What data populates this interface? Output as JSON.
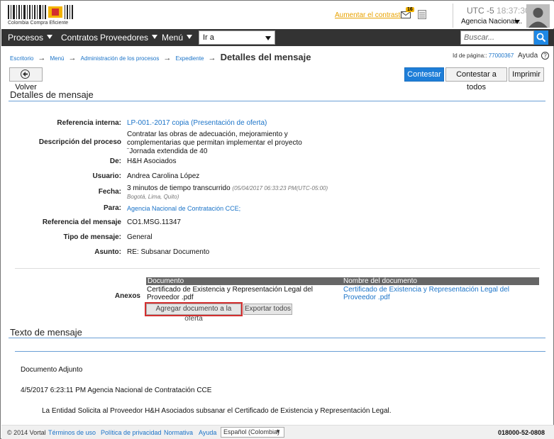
{
  "header": {
    "logo_text": "Colombia Compra Eficiente",
    "contrast_link": "Aumentar el contraste",
    "mail_count": "16",
    "utc_label": "UTC -5",
    "time": "18:37:30",
    "agency": "Agencia Nacional..."
  },
  "nav": {
    "procesos": "Procesos",
    "contratos": "Contratos",
    "proveedores": "Proveedores",
    "menu": "Menú",
    "goto": "Ir a",
    "search_placeholder": "Buscar..."
  },
  "breadcrumb": {
    "items": [
      "Escritorio",
      "Menú",
      "Administración de los procesos",
      "Expediente"
    ],
    "arrow": "→",
    "current": "Detalles del mensaje",
    "page_id_label": "Id de página::",
    "page_id": "77000367",
    "help": "Ayuda",
    "help_icon": "?"
  },
  "toolbar": {
    "back": "Volver",
    "reply": "Contestar",
    "reply_all": "Contestar a todos",
    "print": "Imprimir"
  },
  "details": {
    "title": "Detalles de mensaje",
    "ref_label": "Referencia interna:",
    "ref_value": "LP-001.-2017 copia (Presentación de oferta)",
    "desc_label": "Descripción del proceso",
    "desc_value": "Contratar las obras de adecuación, mejoramiento y complementarias que permitan implementar el proyecto ¨Jornada extendida de 40",
    "from_label": "De:",
    "from_value": "H&H Asociados",
    "user_label": "Usuario:",
    "user_value": "Andrea Carolina López",
    "date_label": "Fecha:",
    "date_value": "3 minutos de tiempo transcurrido",
    "date_note": "(05/04/2017 06:33:23 PM(UTC-05:00)",
    "date_note2": "Bogotá, Lima, Quito)",
    "to_label": "Para:",
    "to_value": "Agencia Nacional de Contratación CCE;",
    "msgref_label": "Referencia del mensaje",
    "msgref_value": "CO1.MSG.11347",
    "type_label": "Tipo de mensaje:",
    "type_value": "General",
    "subject_label": "Asunto:",
    "subject_value": "RE: Subsanar Documento"
  },
  "annexes": {
    "label": "Anexos",
    "col_document": "Documento",
    "col_name": "Nombre del documento",
    "row_document": "Certificado de Existencia y Representación Legal del Proveedor .pdf",
    "row_name": "Certificado de Existencia y Representación Legal del Proveedor .pdf",
    "add_button": "Agregar documento a la oferta",
    "export_button": "Exportar todos"
  },
  "message": {
    "title": "Texto de mensaje",
    "line1": "Documento Adjunto",
    "line2": "4/5/2017 6:23:11 PM Agencia Nacional de Contratación CCE",
    "line3": "La Entidad Solicita al Proveedor H&H Asociados subsanar el Certificado de Existencia y Representación Legal."
  },
  "footer": {
    "copyright": "© 2014 Vortal",
    "terms": "Términos de uso",
    "privacy": "Política de privacidad",
    "rules": "Normativa",
    "help": "Ayuda",
    "language": "Español (Colombia)",
    "phone": "018000-52-0808"
  },
  "colors": {
    "accent": "#1e7ed8",
    "navbar": "#333333",
    "link": "#1a73c8",
    "highlight_outline": "#d32f2f"
  }
}
